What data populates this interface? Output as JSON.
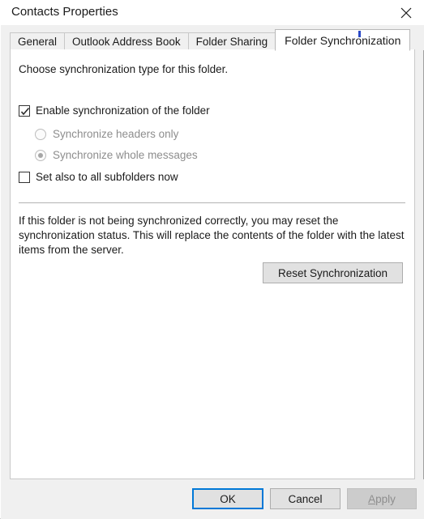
{
  "window": {
    "title": "Contacts Properties",
    "close_icon": "close-icon"
  },
  "tabs": [
    {
      "label": "General",
      "active": false
    },
    {
      "label": "Outlook Address Book",
      "active": false
    },
    {
      "label": "Folder Sharing",
      "active": false
    },
    {
      "label": "Folder Synchronization",
      "active": true
    }
  ],
  "content": {
    "intro": "Choose synchronization type for this folder.",
    "enable_sync": {
      "label": "Enable synchronization of the folder",
      "checked": true
    },
    "sync_mode": {
      "disabled": true,
      "options": [
        {
          "label": "Synchronize headers only",
          "selected": false
        },
        {
          "label": "Synchronize whole messages",
          "selected": true
        }
      ]
    },
    "set_subfolders": {
      "label": "Set also to all subfolders now",
      "checked": false
    },
    "reset_paragraph": "If this folder is not being synchronized correctly, you may reset the synchronization status. This will replace the contents of the folder with the latest items from the server.",
    "reset_button": "Reset Synchronization"
  },
  "footer": {
    "ok": "OK",
    "cancel": "Cancel",
    "apply_accel": "A",
    "apply_rest": "pply",
    "apply_disabled": true
  },
  "colors": {
    "accent": "#0078d7",
    "dialog_bg": "#f0f0f0",
    "panel_bg": "#ffffff",
    "button_face": "#e1e1e1",
    "disabled_text": "#8e8e8e",
    "text": "#1b1b1b"
  }
}
